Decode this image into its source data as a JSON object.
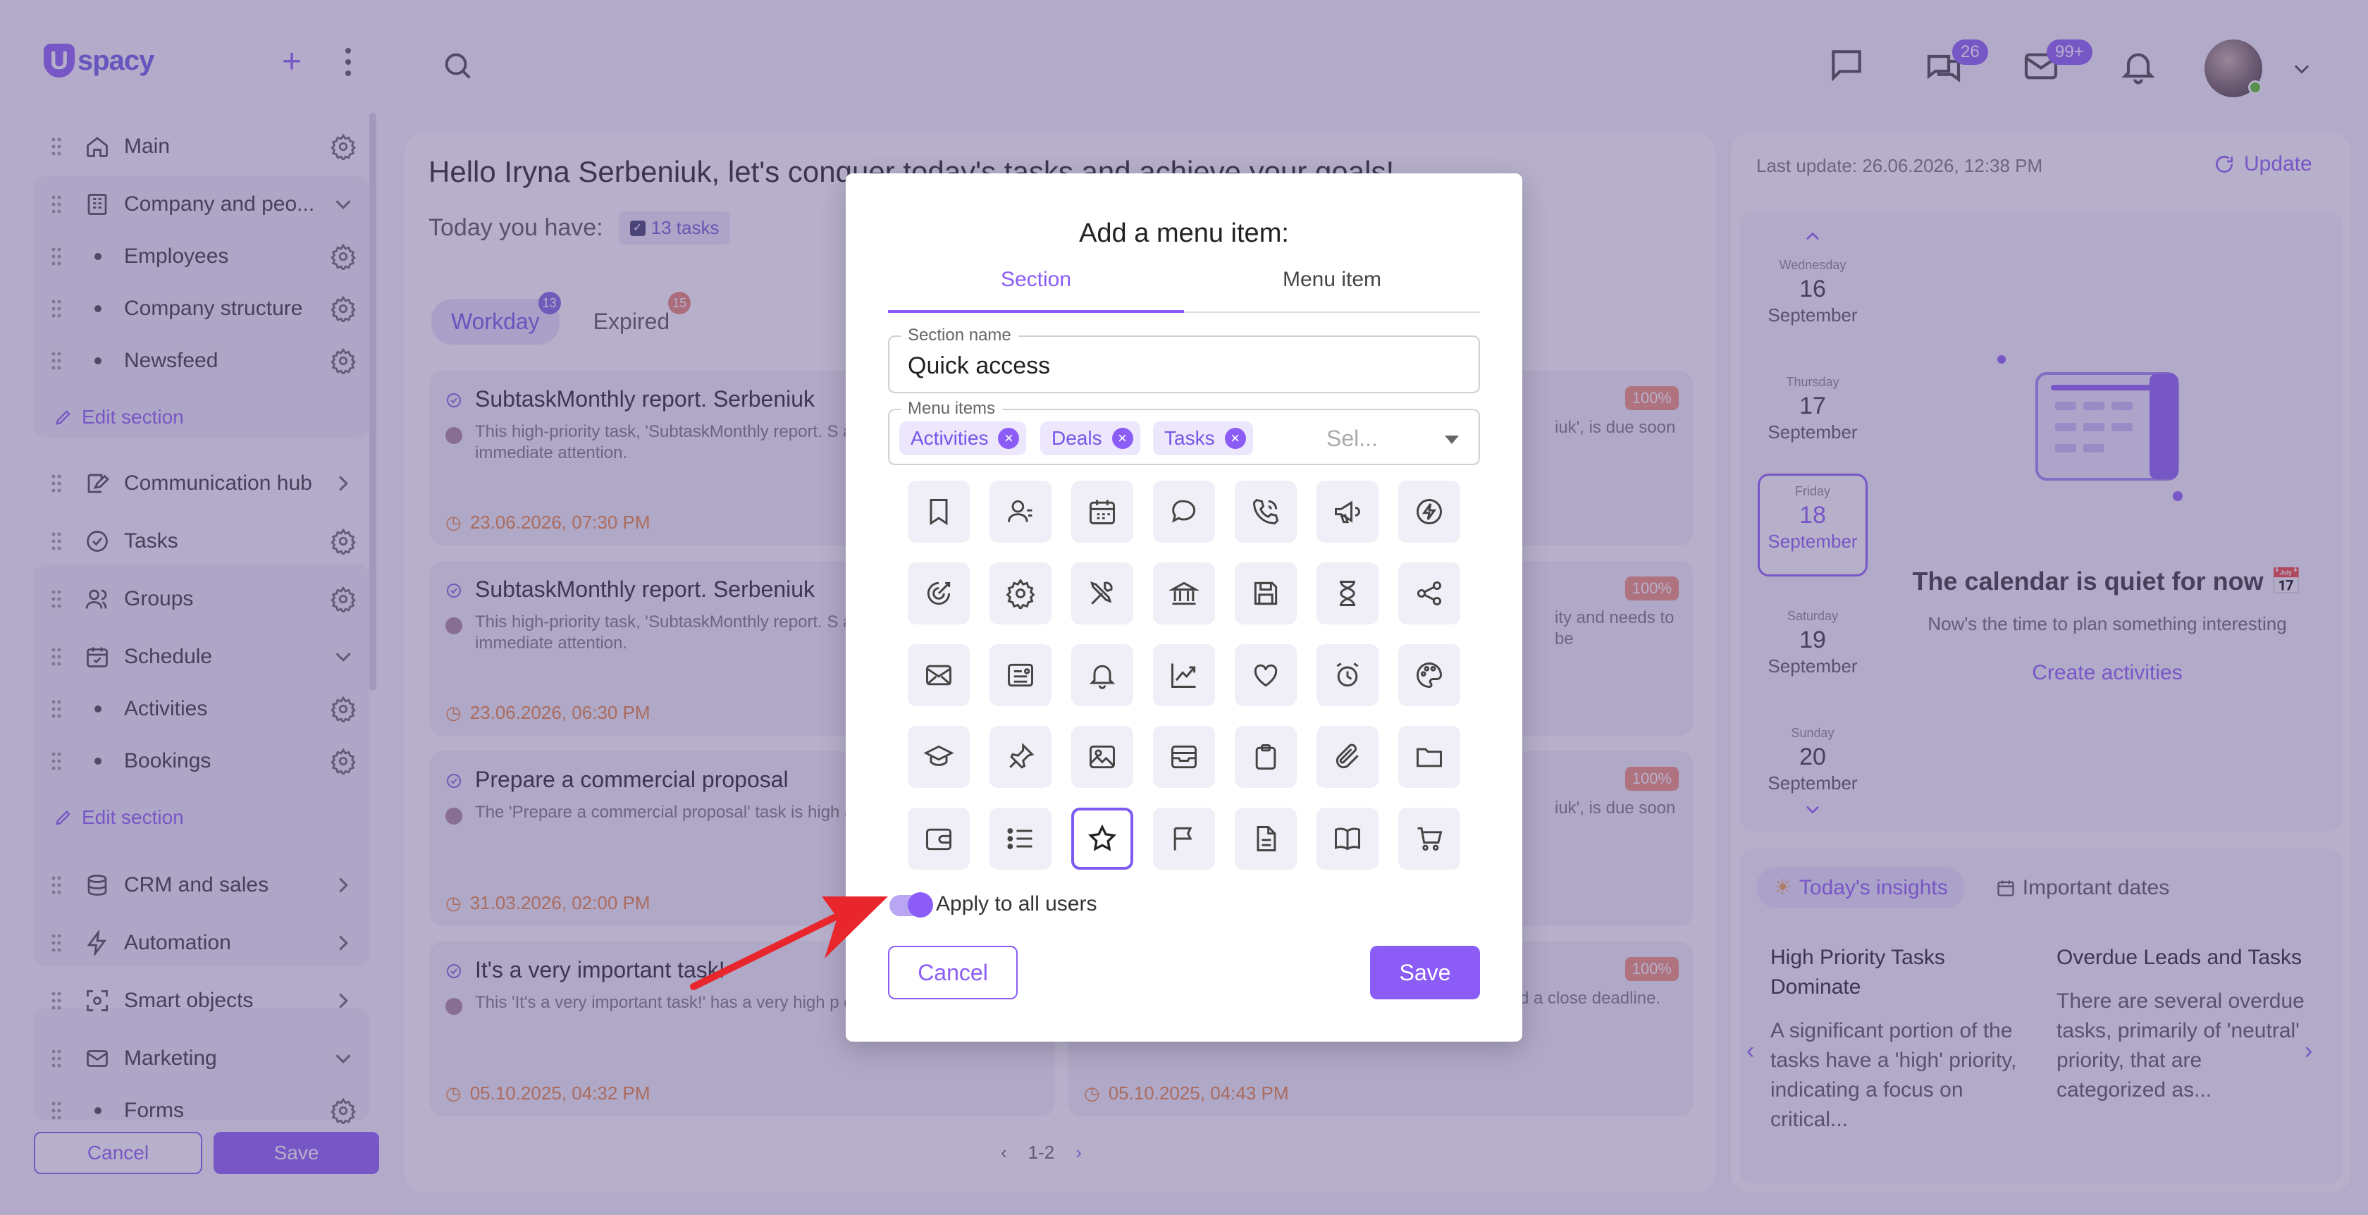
{
  "brand": {
    "name": "spacy",
    "letter": "U"
  },
  "sidebar": {
    "items": [
      {
        "label": "Main",
        "icon": "home-icon"
      },
      {
        "label": "Company and peo...",
        "icon": "building-icon"
      },
      {
        "label": "Employees"
      },
      {
        "label": "Company structure"
      },
      {
        "label": "Newsfeed"
      },
      {
        "label": "Communication hub",
        "icon": "chat-edit-icon"
      },
      {
        "label": "Tasks",
        "icon": "check-circle-icon"
      },
      {
        "label": "Groups",
        "icon": "users-icon"
      },
      {
        "label": "Schedule",
        "icon": "calendar-icon"
      },
      {
        "label": "Activities"
      },
      {
        "label": "Bookings"
      },
      {
        "label": "CRM and sales",
        "icon": "coins-icon"
      },
      {
        "label": "Automation",
        "icon": "bolt-icon"
      },
      {
        "label": "Smart objects",
        "icon": "scan-icon"
      },
      {
        "label": "Marketing",
        "icon": "mail-icon"
      },
      {
        "label": "Forms"
      }
    ],
    "edit_section": "Edit section",
    "cancel": "Cancel",
    "save": "Save"
  },
  "topbar": {
    "chat_badge": "26",
    "mail_badge": "99+"
  },
  "main": {
    "greeting": "Hello Iryna Serbeniuk, let's conquer today's tasks and achieve your goals!",
    "today_label": "Today you have:",
    "tasks_chip": "13 tasks",
    "tabs": [
      {
        "label": "Workday",
        "badge": "13"
      },
      {
        "label": "Expired",
        "badge": "15"
      }
    ],
    "cards": [
      {
        "title": "SubtaskMonthly report. Serbeniuk",
        "desc": "This high-priority task, 'SubtaskMonthly report. S and requires your immediate attention.",
        "date": "23.06.2026, 07:30 PM"
      },
      {
        "title": "SubtaskMonthly report. Serbeniuk",
        "desc": "This high-priority task, 'SubtaskMonthly report. S and requires your immediate attention.",
        "date": "23.06.2026, 06:30 PM"
      },
      {
        "title": "Prepare a commercial proposal",
        "desc": "The 'Prepare a commercial proposal' task is high addressed today.",
        "date": "31.03.2026, 02:00 PM"
      },
      {
        "title": "It's a very important task!",
        "desc": "This 'It's a very important task!' has a very high p deadline.",
        "date": "05.10.2025, 04:32 PM"
      }
    ],
    "right_cards": [
      {
        "desc": "iuk', is due soon",
        "pct": "100%"
      },
      {
        "desc": "ity and needs to be",
        "pct": "100%"
      },
      {
        "desc": "iuk', is due soon",
        "pct": "100%"
      },
      {
        "desc": "d a close deadline.",
        "pct": "100%",
        "date": "05.10.2025, 04:43 PM"
      }
    ],
    "pager": "1-2"
  },
  "right": {
    "last_update": "Last update: 26.06.2026, 12:38 PM",
    "update": "Update",
    "days": [
      {
        "name": "Wednesday",
        "num": "16",
        "month": "September"
      },
      {
        "name": "Thursday",
        "num": "17",
        "month": "September"
      },
      {
        "name": "Friday",
        "num": "18",
        "month": "September"
      },
      {
        "name": "Saturday",
        "num": "19",
        "month": "September"
      },
      {
        "name": "Sunday",
        "num": "20",
        "month": "September"
      }
    ],
    "quiet_title": "The calendar is quiet for now 📅",
    "quiet_sub": "Now's the time to plan something interesting",
    "create": "Create activities",
    "insights_tab": "Today's insights",
    "dates_tab": "Important dates",
    "insights": [
      {
        "title": "High Priority Tasks Dominate",
        "body": "A significant portion of the tasks have a 'high' priority, indicating a focus on critical..."
      },
      {
        "title": "Overdue Leads and Tasks",
        "body": "There are several overdue tasks, primarily of 'neutral' priority, that are categorized as..."
      }
    ]
  },
  "modal": {
    "title": "Add a menu item:",
    "tab_section": "Section",
    "tab_menu_item": "Menu item",
    "section_name_label": "Section name",
    "section_name_value": "Quick access",
    "menu_items_label": "Menu items",
    "chips": [
      "Activities",
      "Deals",
      "Tasks"
    ],
    "select_placeholder": "Sel...",
    "icons": [
      "bookmark-icon",
      "contacts-icon",
      "calendar-icon",
      "chat-icon",
      "phone-icon",
      "megaphone-icon",
      "lightning-icon",
      "target-icon",
      "settings-icon",
      "tools-icon",
      "bank-icon",
      "save-icon",
      "hourglass-icon",
      "share-icon",
      "mail-icon",
      "news-icon",
      "bell-icon",
      "chart-icon",
      "heart-icon",
      "alarm-icon",
      "palette-icon",
      "graduation-icon",
      "pin-icon",
      "image-icon",
      "archive-icon",
      "clipboard-icon",
      "paperclip-icon",
      "folder-icon",
      "wallet-icon",
      "list-icon",
      "star-icon",
      "flag-icon",
      "document-icon",
      "book-icon",
      "cart-icon"
    ],
    "selected_icon": "star-icon",
    "apply_all": "Apply to all users",
    "apply_all_on": true,
    "cancel": "Cancel",
    "save": "Save"
  },
  "colors": {
    "accent": "#8b5cf6",
    "overlay": "#60508c",
    "danger_arrow": "#e8262c",
    "date_orange": "#e8843a"
  }
}
